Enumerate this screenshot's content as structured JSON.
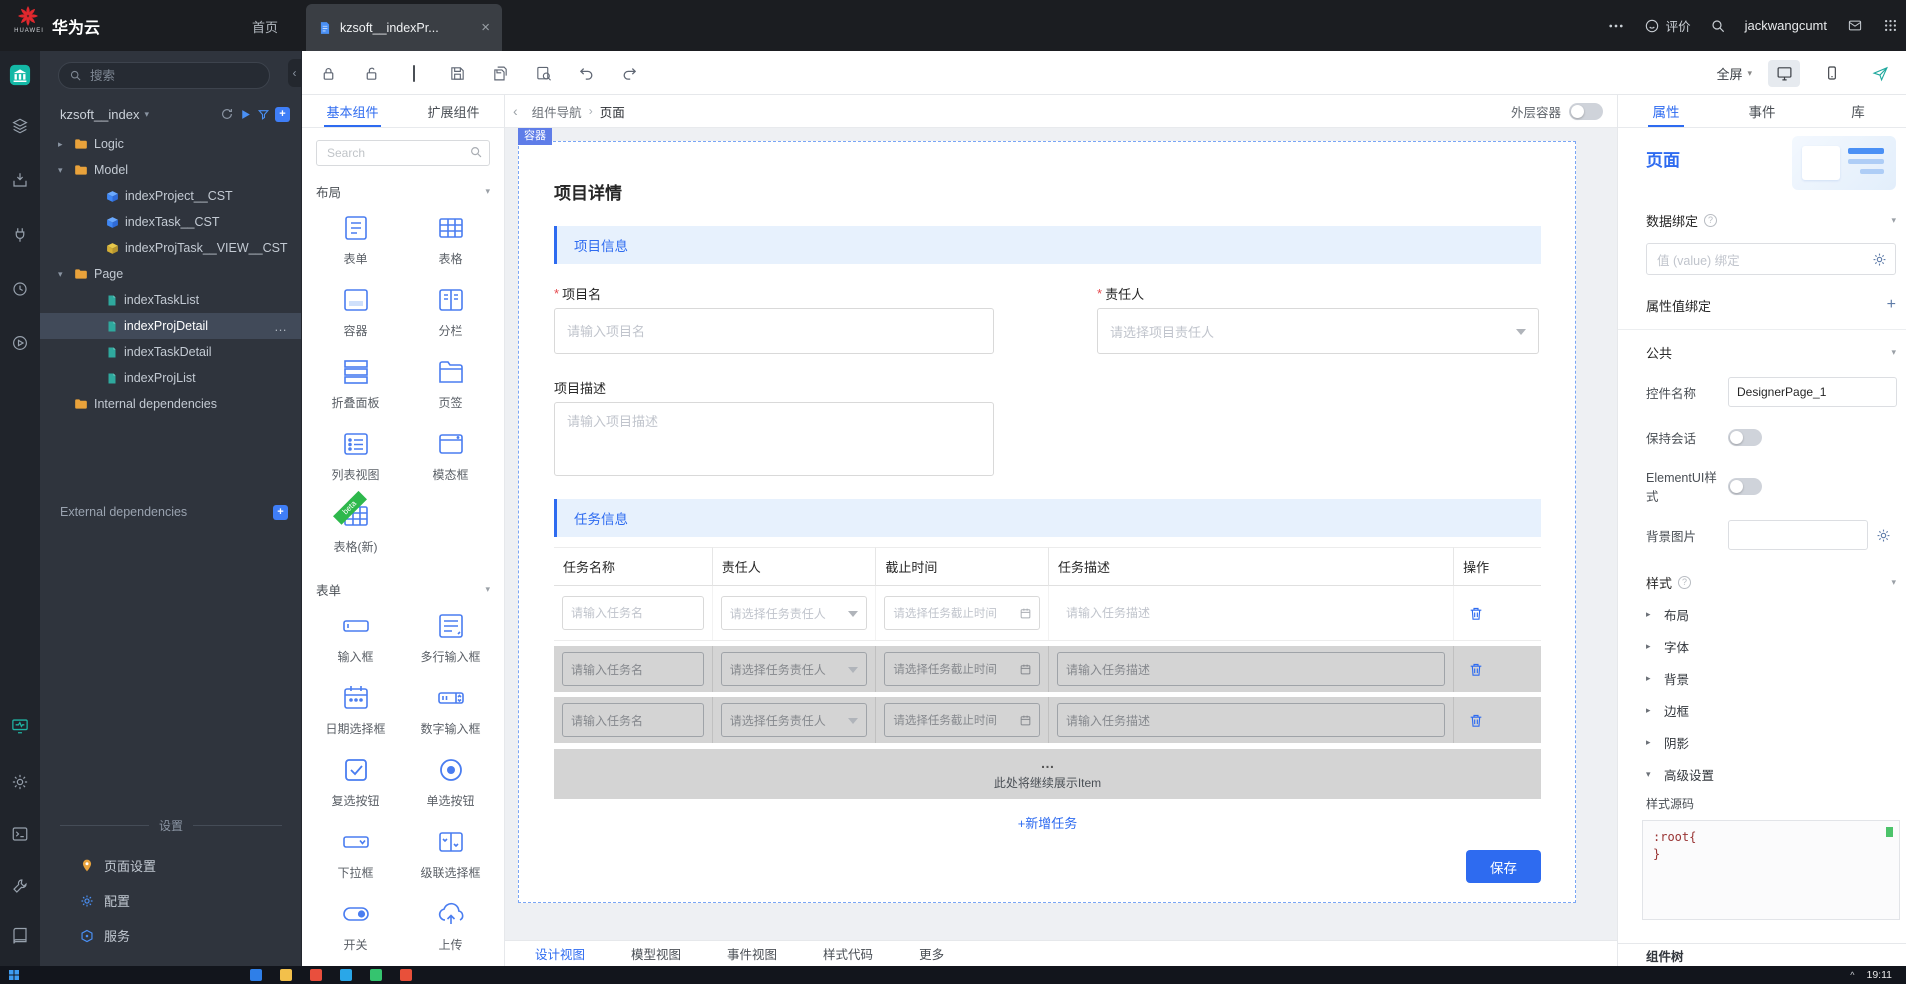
{
  "colors": {
    "accent": "#2e6bf0",
    "section_bg": "#e7f1fd",
    "beta_green": "#2eb84c",
    "selected_row": "#414a59",
    "huawei_red": "#e0282e"
  },
  "glyphs": {
    "close": "×",
    "ellipsis": "…",
    "crumb_sep": "›",
    "collapse_left": "‹",
    "caret_down": "▾",
    "caret_right": "▸",
    "plus": "+",
    "asterisk": "*"
  },
  "topbar": {
    "brand": "华为云",
    "brand_sub": "HUAWEI",
    "home": "首页",
    "tab_title": "kzsoft__indexPr...",
    "feedback": "评价",
    "username": "jackwangcumt"
  },
  "toolbar": {
    "fullscreen": "全屏"
  },
  "explorer": {
    "search_placeholder": "搜索",
    "project_name": "kzsoft__index",
    "tree": [
      {
        "label": "Logic"
      },
      {
        "label": "Model"
      },
      {
        "label": "indexProject__CST"
      },
      {
        "label": "indexTask__CST"
      },
      {
        "label": "indexProjTask__VIEW__CST"
      },
      {
        "label": "Page"
      },
      {
        "label": "indexTaskList"
      },
      {
        "label": "indexProjDetail"
      },
      {
        "label": "indexTaskDetail"
      },
      {
        "label": "indexProjList"
      },
      {
        "label": "Internal dependencies"
      }
    ],
    "external_label": "External dependencies",
    "settings_title": "设置",
    "settings_items": [
      "页面设置",
      "配置",
      "服务"
    ]
  },
  "palette": {
    "tabs": [
      "基本组件",
      "扩展组件"
    ],
    "search_placeholder": "Search",
    "beta_badge": "beta",
    "sections": [
      {
        "title": "布局",
        "items": [
          "表单",
          "表格",
          "容器",
          "分栏",
          "折叠面板",
          "页签",
          "列表视图",
          "模态框",
          "表格(新)"
        ]
      },
      {
        "title": "表单",
        "items": [
          "输入框",
          "多行输入框",
          "日期选择框",
          "数字输入框",
          "复选按钮",
          "单选按钮",
          "下拉框",
          "级联选择框",
          "开关",
          "上传"
        ]
      }
    ]
  },
  "breadcrumb": {
    "root": "组件导航",
    "current": "页面",
    "outer_container": "外层容器"
  },
  "canvas": {
    "container_tag": "容器",
    "title": "项目详情",
    "info_section": "项目信息",
    "task_section": "任务信息",
    "project_name_label": "项目名",
    "project_name_placeholder": "请输入项目名",
    "owner_label": "责任人",
    "owner_placeholder": "请选择项目责任人",
    "desc_label": "项目描述",
    "desc_placeholder": "请输入项目描述",
    "table_headers": [
      "任务名称",
      "责任人",
      "截止时间",
      "任务描述",
      "操作"
    ],
    "task_name_placeholder": "请输入任务名",
    "task_owner_placeholder": "请选择任务责任人",
    "task_deadline_placeholder": "请选择任务截止时间",
    "task_desc_placeholder": "请输入任务描述",
    "more_ellipsis": "…",
    "more_hint": "此处将继续展示Item",
    "add_task": "+新增任务",
    "save": "保存"
  },
  "view_tabs": [
    "设计视图",
    "模型视图",
    "事件视图",
    "样式代码",
    "更多"
  ],
  "inspector": {
    "tabs": [
      "属性",
      "事件",
      "库"
    ],
    "page_title": "页面",
    "binding_title": "数据绑定",
    "value_binding_placeholder": "值 (value) 绑定",
    "prop_binding": "属性值绑定",
    "common_title": "公共",
    "control_name_label": "控件名称",
    "control_name_value": "DesignerPage_1",
    "keep_session_label": "保持会话",
    "elementui_label": "ElementUI样式",
    "bg_image_label": "背景图片",
    "style_title": "样式",
    "style_groups": [
      "布局",
      "字体",
      "背景",
      "边框",
      "阴影"
    ],
    "advanced_label": "高级设置",
    "source_label": "样式源码",
    "source_code": ":root{\n}",
    "component_tree": "组件树"
  },
  "taskbar": {
    "time": "19:11"
  }
}
